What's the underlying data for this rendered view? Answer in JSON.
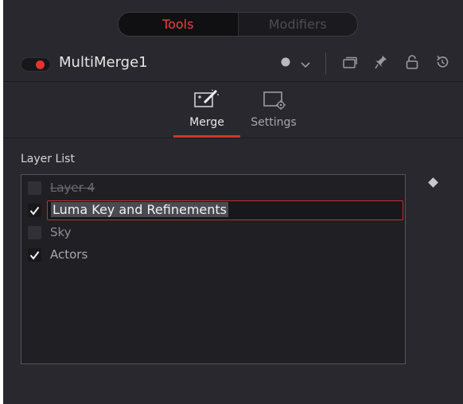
{
  "tabs": {
    "tools_label": "Tools",
    "modifiers_label": "Modifiers"
  },
  "header": {
    "node_name": "MultiMerge1",
    "toggle_state": "on"
  },
  "panel_tabs": [
    {
      "label": "Merge",
      "icon": "merge-icon",
      "active": true
    },
    {
      "label": "Settings",
      "icon": "settings-icon",
      "active": false
    }
  ],
  "layer_list": {
    "label": "Layer List",
    "layers": [
      {
        "name": "Layer 4",
        "checked": false,
        "strikethrough": true
      },
      {
        "name": "Luma Key and Refinements",
        "checked": true,
        "editing": true
      },
      {
        "name": "Sky",
        "checked": false
      },
      {
        "name": "Actors",
        "checked": true
      }
    ]
  },
  "colors": {
    "accent": "#e5322d",
    "background": "#28282e"
  }
}
